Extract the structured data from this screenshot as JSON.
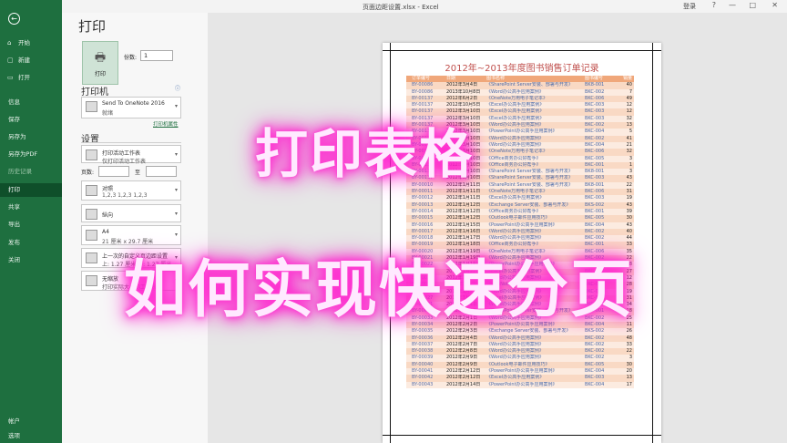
{
  "window": {
    "doc_title": "页面边距设置.xlsx - Excel",
    "login": "登录",
    "controls": [
      "?",
      "—",
      "□",
      "✕"
    ]
  },
  "nav": {
    "back": "←",
    "items": [
      {
        "label": "开始",
        "icon": "⌂"
      },
      {
        "label": "新建",
        "icon": "▢"
      },
      {
        "label": "打开",
        "icon": "▭"
      },
      {
        "label": "信息",
        "icon": ""
      },
      {
        "label": "保存",
        "icon": ""
      },
      {
        "label": "另存为",
        "icon": ""
      },
      {
        "label": "另存为PDF",
        "icon": ""
      },
      {
        "label": "历史记录",
        "icon": ""
      },
      {
        "label": "打印",
        "icon": ""
      },
      {
        "label": "共享",
        "icon": ""
      },
      {
        "label": "导出",
        "icon": ""
      },
      {
        "label": "发布",
        "icon": ""
      },
      {
        "label": "关闭",
        "icon": ""
      }
    ],
    "bottom": [
      {
        "label": "帐户"
      },
      {
        "label": "选项"
      }
    ]
  },
  "panel": {
    "title": "打印",
    "print_button": "打印",
    "copies_label": "份数:",
    "copies_value": "1",
    "printer_heading": "打印机",
    "printer_name": "Send To OneNote 2016",
    "printer_status": "就绪",
    "printer_props": "打印机属性",
    "settings_heading": "设置",
    "scope_1": "打印活动工作表",
    "scope_2": "仅打印活动工作表",
    "pages_label": "页数:",
    "to_label": "至",
    "collate_1": "对照",
    "collate_2": "1,2,3    1,2,3    1,2,3",
    "orientation": "纵向",
    "paper_1": "A4",
    "paper_2": "21 厘米 x 29.7 厘米",
    "margins_1": "上一次的自定义页边距设置",
    "margins_2": "上: 1.27 厘米 下: 1.27 厘米",
    "scale_1": "无缩放",
    "scale_2": "打印实际大小的工作表"
  },
  "preview": {
    "sheet_title": "2012年~2013年度图书销售订单记录",
    "headers": [
      "订单编号",
      "日期",
      "图书名称",
      "图书编号",
      "销量"
    ],
    "rows": [
      [
        "BY-00086",
        "2012年3月4日",
        "《SharePoint Server安装、部署与开发》",
        "BK8-001",
        "40"
      ],
      [
        "BY-00086",
        "2013年10月8日",
        "《Word办公高手应用案例》",
        "BKC-002",
        "7"
      ],
      [
        "BY-00137",
        "2012年6月2日",
        "《OneNote万用电子笔记本》",
        "BKC-006",
        "49"
      ],
      [
        "BY-00137",
        "2012年10月5日",
        "《Excel办公高手应用案例》",
        "BKC-003",
        "12"
      ],
      [
        "BY-00137",
        "2012年3月10日",
        "《Excel办公高手应用案例》",
        "BKC-003",
        "12"
      ],
      [
        "BY-00137",
        "2012年3月10日",
        "《Excel办公高手应用案例》",
        "BKC-003",
        "32"
      ],
      [
        "BY-00137",
        "2012年3月10日",
        "《Word办公高手应用案例》",
        "BKC-002",
        "13"
      ],
      [
        "BY-00137",
        "2012年3月10日",
        "《PowerPoint办公高手应用案例》",
        "BKC-004",
        "5"
      ],
      [
        "BY-00137",
        "2012年3月10日",
        "《Word办公高手应用案例》",
        "BKC-002",
        "41"
      ],
      [
        "BY-00137",
        "2012年3月10日",
        "《Word办公高手应用案例》",
        "BKC-004",
        "21"
      ],
      [
        "BY-00137",
        "2012年3月10日",
        "《OneNote万用电子笔记本》",
        "BKC-006",
        "32"
      ],
      [
        "BY-00137",
        "2012年3月10日",
        "《Office商务办公好帮手》",
        "BKC-005",
        "3"
      ],
      [
        "BY-00137",
        "2012年3月10日",
        "《Office商务办公好帮手》",
        "BKC-001",
        "1"
      ],
      [
        "BY-00137",
        "2012年3月10日",
        "《SharePoint Server安装、部署与开发》",
        "BK8-001",
        "3"
      ],
      [
        "BY-00137",
        "2012年3月10日",
        "《SharePoint Server安装、部署与开发》",
        "BKC-003",
        "43"
      ],
      [
        "BY-00010",
        "2012年1月11日",
        "《SharePoint Server安装、部署与开发》",
        "BK8-001",
        "22"
      ],
      [
        "BY-00011",
        "2012年1月11日",
        "《OneNote万用电子笔记本》",
        "BKC-006",
        "31"
      ],
      [
        "BY-00012",
        "2012年1月11日",
        "《Excel办公高手应用案例》",
        "BKC-003",
        "19"
      ],
      [
        "BY-00013",
        "2012年1月12日",
        "《Exchange Server安装、部署与开发》",
        "BKS-002",
        "43"
      ],
      [
        "BY-00014",
        "2012年1月12日",
        "《Office商务办公好帮手》",
        "BKC-001",
        "39"
      ],
      [
        "BY-00015",
        "2012年1月12日",
        "《Outlook电子邮件应用技巧》",
        "BKC-005",
        "30"
      ],
      [
        "BY-00016",
        "2012年1月15日",
        "《PowerPoint办公高手应用案例》",
        "BKC-004",
        "43"
      ],
      [
        "BY-00017",
        "2012年1月16日",
        "《Word办公高手应用案例》",
        "BKC-002",
        "40"
      ],
      [
        "BY-00018",
        "2012年1月17日",
        "《Word办公高手应用案例》",
        "BKC-002",
        "44"
      ],
      [
        "BY-00019",
        "2012年1月18日",
        "《Office商务办公好帮手》",
        "BKC-001",
        "33"
      ],
      [
        "BY-00020",
        "2012年1月19日",
        "《OneNote万用电子笔记本》",
        "BKC-006",
        "35"
      ],
      [
        "BY-00021",
        "2012年1月19日",
        "《Word办公高手应用案例》",
        "BKC-002",
        "22"
      ],
      [
        "BY-00022",
        "2012年1月19日",
        "《PowerPoint办公高手应用案例》",
        "BKC-004",
        "38"
      ],
      [
        "BY-00023",
        "2012年1月22日",
        "《Excel办公高手应用案例》",
        "BKC-003",
        "27"
      ],
      [
        "BY-00024",
        "2012年1月24日",
        "《Word办公高手应用案例》",
        "BKC-002",
        "12"
      ],
      [
        "BY-00025",
        "2012年1月25日",
        "《OneNote万用电子笔记本》",
        "BKC-006",
        "28"
      ],
      [
        "BY-00026",
        "2012年1月26日",
        "《Word办公高手应用案例》",
        "BKC-002",
        "19"
      ],
      [
        "BY-00027",
        "2012年1月26日",
        "《Excel办公高手应用案例》",
        "BKC-003",
        "31"
      ],
      [
        "BY-00031",
        "2012年2月1日",
        "《Word办公高手应用案例》",
        "BKC-002",
        "34"
      ],
      [
        "BY-00032",
        "2012年2月1日",
        "《SharePoint Server安装、部署与开发》",
        "BK8-001",
        "18"
      ],
      [
        "BY-00033",
        "2012年2月1日",
        "《Word办公高手应用案例》",
        "BKC-002",
        "25"
      ],
      [
        "BY-00034",
        "2012年2月2日",
        "《PowerPoint办公高手应用案例》",
        "BKC-004",
        "11"
      ],
      [
        "BY-00035",
        "2012年2月3日",
        "《Exchange Server安装、部署与开发》",
        "BKS-002",
        "26"
      ],
      [
        "BY-00036",
        "2012年2月4日",
        "《Word办公高手应用案例》",
        "BKC-002",
        "48"
      ],
      [
        "BY-00037",
        "2012年2月7日",
        "《Word办公高手应用案例》",
        "BKC-002",
        "33"
      ],
      [
        "BY-00038",
        "2012年2月8日",
        "《Word办公高手应用案例》",
        "BKC-002",
        "22"
      ],
      [
        "BY-00039",
        "2012年2月9日",
        "《Word办公高手应用案例》",
        "BKC-002",
        "3"
      ],
      [
        "BY-00040",
        "2012年2月9日",
        "《Outlook电子邮件应用技巧》",
        "BKC-005",
        "30"
      ],
      [
        "BY-00041",
        "2012年2月12日",
        "《PowerPoint办公高手应用案例》",
        "BKC-004",
        "20"
      ],
      [
        "BY-00042",
        "2012年2月12日",
        "《Excel办公高手应用案例》",
        "BKC-003",
        "13"
      ],
      [
        "BY-00043",
        "2012年2月14日",
        "《PowerPoint办公高手应用案例》",
        "BKC-004",
        "17"
      ]
    ]
  },
  "overlay": {
    "line1": "打印表格",
    "line2": "如何实现快速分页"
  }
}
